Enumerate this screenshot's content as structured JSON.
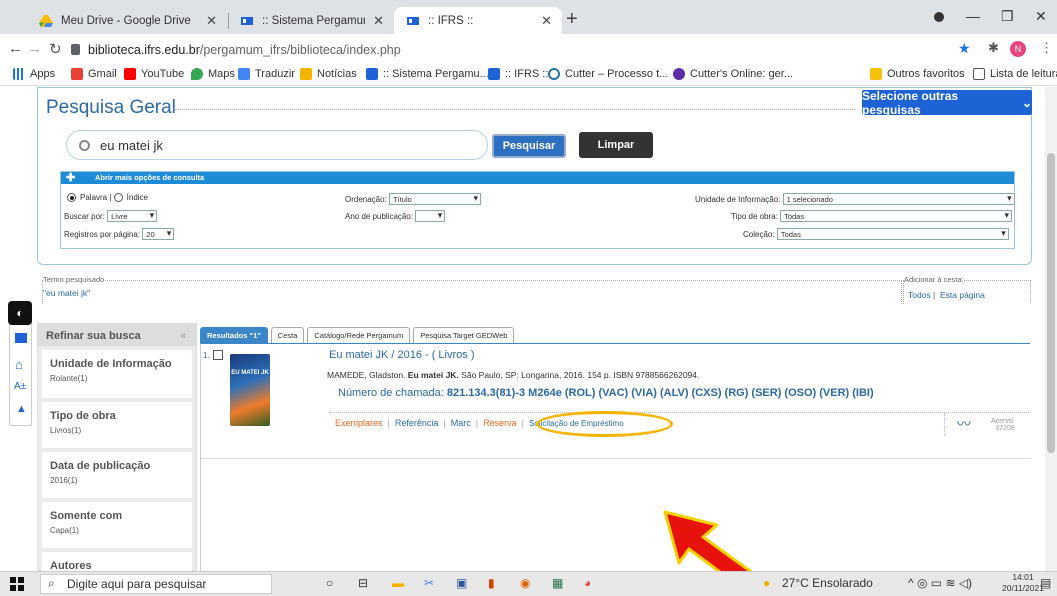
{
  "browser": {
    "tabs": [
      {
        "title": "Meu Drive - Google Drive",
        "favicon_color": "#34a853"
      },
      {
        "title": ":: Sistema Pergamum ::",
        "favicon_color": "#1e63d6"
      },
      {
        "title": ":: IFRS ::",
        "favicon_color": "#1e63d6"
      }
    ],
    "url_host": "biblioteca.ifrs.edu.br",
    "url_path": "/pergamum_ifrs/biblioteca/index.php",
    "profile_initial": "N",
    "bookmarks": [
      "Apps",
      "Gmail",
      "YouTube",
      "Maps",
      "Traduzir",
      "Notícias",
      ":: Sistema Pergamu...",
      ":: IFRS ::",
      "Cutter – Processo t...",
      "Cutter's Online: ger..."
    ],
    "other_bookmarks": "Outros favoritos",
    "reading_list": "Lista de leitura"
  },
  "search": {
    "title": "Pesquisa Geral",
    "other_searches": "Selecione outras pesquisas",
    "query": "eu matei jk",
    "search_button": "Pesquisar",
    "clear_button": "Limpar",
    "more_options": "Abrir mais opções de consulta",
    "word_option": "Palavra",
    "index_option": "Índice",
    "buscar_por_label": "Buscar por:",
    "buscar_por_value": "Livre",
    "registros_label": "Registros por página:",
    "registros_value": "20",
    "ordenacao_label": "Ordenação:",
    "ordenacao_value": "Título",
    "ano_label": "Ano de publicação:",
    "unidade_label": "Unidade de Informação:",
    "unidade_value": "1 selecionado",
    "tipo_label": "Tipo de obra:",
    "tipo_value": "Todas",
    "colecao_label": "Coleção:",
    "colecao_value": "Todas"
  },
  "term": {
    "label": "Termo pesquisado",
    "value": "\"eu matei jk\"",
    "cesta_label": "Adicionar à cesta:",
    "cesta_all": "Todos",
    "cesta_page": "Esta página"
  },
  "refine": {
    "title": "Refinar sua busca",
    "facets": [
      {
        "title": "Unidade de Informação",
        "sub": "Rolante(1)"
      },
      {
        "title": "Tipo de obra",
        "sub": "Livros(1)"
      },
      {
        "title": "Data de publicação",
        "sub": "2016(1)"
      },
      {
        "title": "Somente com",
        "sub": "Capa(1)"
      },
      {
        "title": "Autores",
        "sub": ""
      }
    ]
  },
  "results": {
    "tabs": [
      "Resultados \"1\"",
      "Cesta",
      "Catálogo/Rede Pergamum",
      "Pesquisa Target GEDWeb"
    ],
    "item_number": "1.",
    "cover_text": "EU MATEI JK",
    "item_title": "Eu matei JK / 2016 - ( Livros )",
    "reference_prefix": "MAMEDE, Gladston. ",
    "reference_title": "Eu matei JK.",
    "reference_suffix": " São Paulo, SP: Longarina, 2016. 154 p. ISBN 9788566262094.",
    "call_label": "Número de chamada: ",
    "call_number": "821.134.3(81)-3 M264e (ROL) (VAC) (VIA) (ALV) (CXS) (RG) (SER) (OSO) (VER) (IBI)",
    "links": [
      "Exemplares",
      "Referência",
      "Marc",
      "Reserva",
      "Solicitação de Empréstimo"
    ],
    "acervo_label": "Acervo:",
    "acervo_value": "37208"
  },
  "taskbar": {
    "search_placeholder": "Digite aqui para pesquisar",
    "weather": "27°C  Ensolarado",
    "time": "14:01",
    "date": "20/11/2021"
  },
  "colors": {
    "accent": "#1e63d6",
    "link": "#2b6aa7",
    "orange": "#e86a1c",
    "highlight": "#f6b400",
    "arrow": "#e8120c"
  }
}
